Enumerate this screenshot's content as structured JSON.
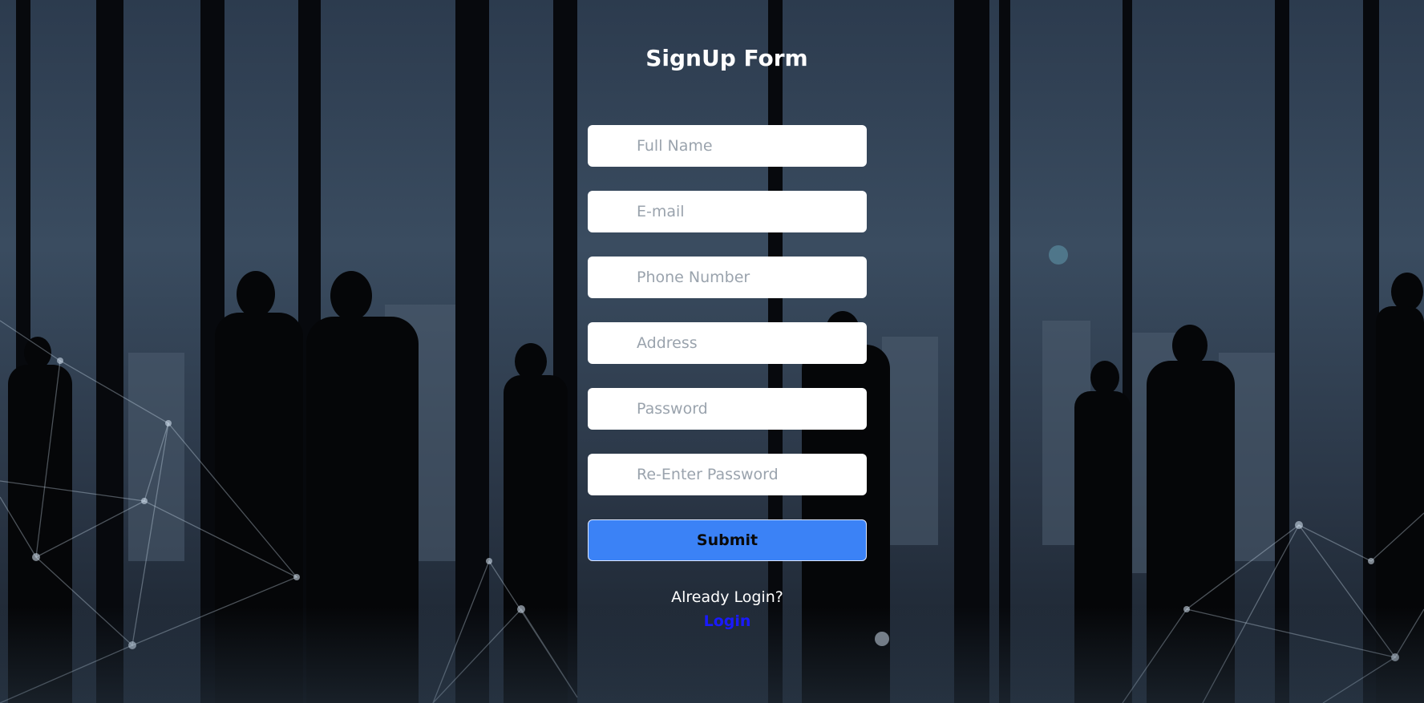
{
  "form": {
    "title": "SignUp Form",
    "fields": [
      {
        "placeholder": "Full Name",
        "value": ""
      },
      {
        "placeholder": "E-mail",
        "value": ""
      },
      {
        "placeholder": "Phone Number",
        "value": ""
      },
      {
        "placeholder": "Address",
        "value": ""
      },
      {
        "placeholder": "Password",
        "value": ""
      },
      {
        "placeholder": "Re-Enter Password",
        "value": ""
      }
    ],
    "submit_label": "Submit",
    "already_text": "Already Login?",
    "login_label": "Login"
  },
  "colors": {
    "submit_bg": "#3b82f6",
    "login_link": "#1a1aff",
    "title": "#ffffff"
  }
}
